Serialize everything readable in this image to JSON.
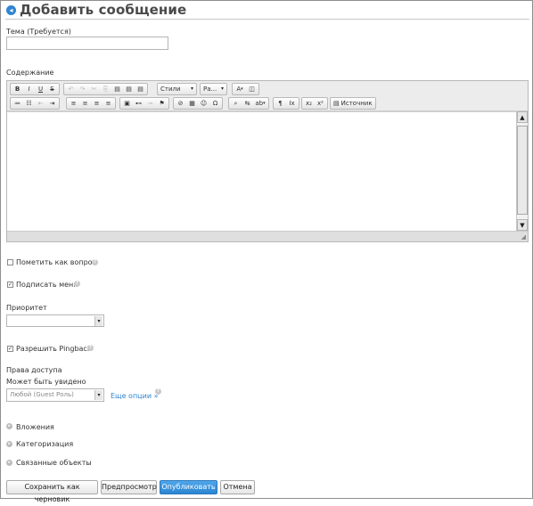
{
  "header": {
    "title": "Добавить сообщение",
    "icon": "back-arrow-icon"
  },
  "subject": {
    "label": "Тема (Требуется)",
    "value": ""
  },
  "content": {
    "label": "Содержание"
  },
  "toolbar": {
    "row1": {
      "format": [
        "B",
        "I",
        "U",
        "S"
      ],
      "clipboard": [
        "↶",
        "↷",
        "✂",
        "⎘",
        "📋",
        "📋",
        "📋"
      ],
      "styles_label": "Стили",
      "font_label": "Ра...",
      "text_color": "A",
      "bg_color": "◫"
    },
    "row2": {
      "lists": [
        "≔",
        "☷",
        "⇤",
        "⇥"
      ],
      "align": [
        "≡",
        "≡",
        "≡",
        "≡"
      ],
      "insert": [
        "▣",
        "⊷",
        "⊸",
        "⚑"
      ],
      "objects": [
        "⊘",
        "▦",
        "☺",
        "Ω"
      ],
      "find": [
        "🔍",
        "⇆",
        "ab"
      ],
      "blocks": [
        "¶",
        "Ix"
      ],
      "scripts": [
        "x₂",
        "x²"
      ],
      "source_label": "Источник"
    }
  },
  "options": {
    "mark_question": "Пометить как вопрос",
    "subscribe": "Подписать меня",
    "priority_label": "Приоритет",
    "priority_value": "",
    "allow_pingback": "Разрешить Pingback"
  },
  "access": {
    "title": "Права доступа",
    "visible_label": "Может быть увидено",
    "visible_value": "Любой (Guest Роль)",
    "more_options": "Еще опции »"
  },
  "sections": [
    "Вложения",
    "Категоризация",
    "Связанные объекты"
  ],
  "buttons": {
    "save_draft": "Сохранить как черновик",
    "preview": "Предпросмотр",
    "publish": "Опубликовать",
    "cancel": "Отмена"
  },
  "state": {
    "mark_question": false,
    "subscribe": true,
    "allow_pingback": true
  },
  "colors": {
    "accent": "#2f84d1",
    "publish_button": "#2b85d1"
  }
}
